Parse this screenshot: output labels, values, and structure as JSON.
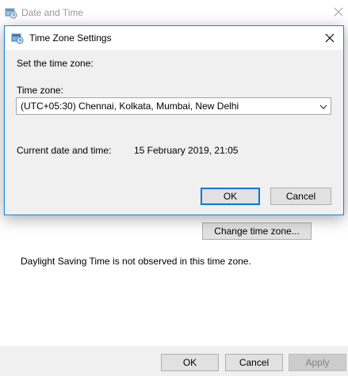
{
  "parent_window": {
    "title": "Date and Time",
    "change_timezone_label": "Change time zone...",
    "dst_text": "Daylight Saving Time is not observed in this time zone.",
    "footer": {
      "ok_label": "OK",
      "cancel_label": "Cancel",
      "apply_label": "Apply"
    }
  },
  "dialog": {
    "title": "Time Zone Settings",
    "set_label": "Set the time zone:",
    "timezone_label": "Time zone:",
    "timezone_value": "(UTC+05:30) Chennai, Kolkata, Mumbai, New Delhi",
    "current_label": "Current date and time:",
    "current_value": "15 February 2019, 21:05",
    "ok_label": "OK",
    "cancel_label": "Cancel"
  },
  "icons": {
    "window_icon": "date-time-icon",
    "close": "close-icon",
    "dropdown": "chevron-down-icon"
  },
  "colors": {
    "accent": "#0078d7",
    "dialog_border": "#1883d7",
    "face": "#f0f0f0"
  }
}
